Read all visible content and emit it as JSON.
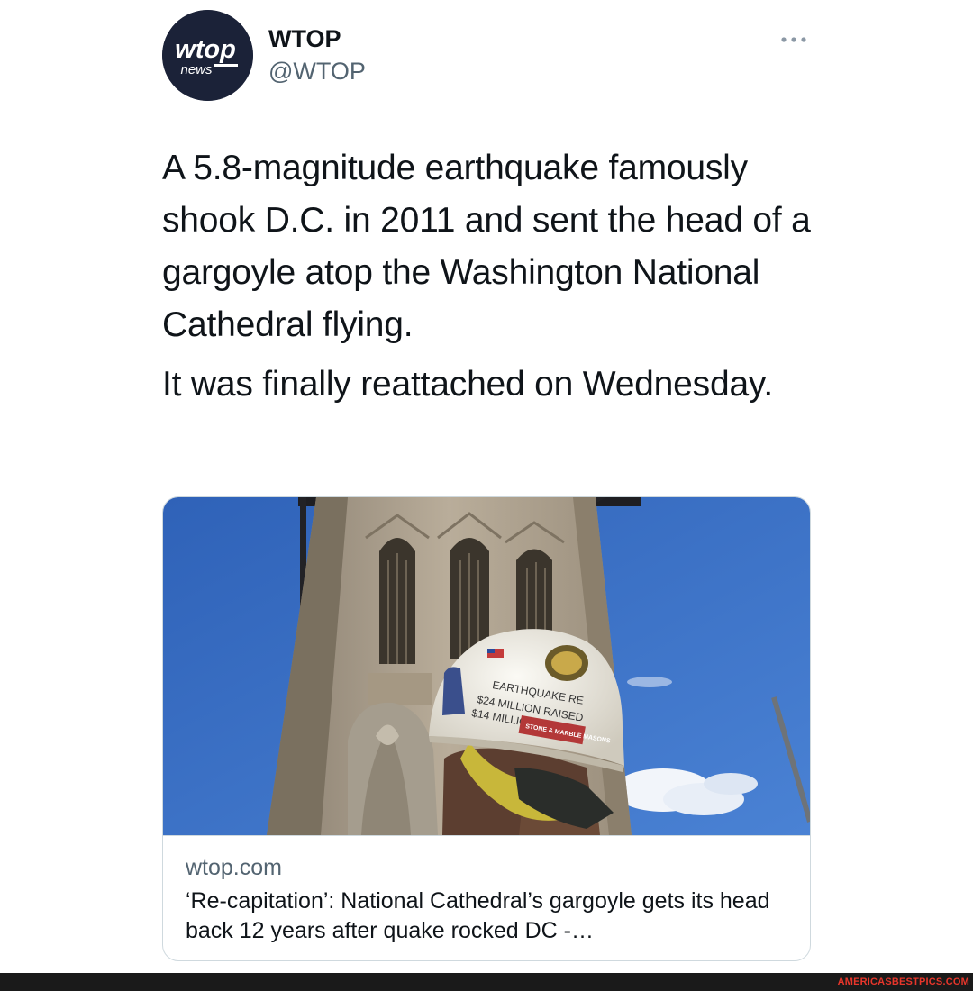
{
  "author": {
    "avatar_icon": "wtop-news-logo-icon",
    "logo_word": "wtop",
    "logo_sub": "news",
    "display_name": "WTOP",
    "handle": "@WTOP"
  },
  "menu": {
    "icon": "more-horizontal-icon"
  },
  "tweet": {
    "paragraphs": [
      "A 5.8-magnitude earthquake famously shook D.C. in 2011 and sent the head of a gargoyle atop the Washington National Cathedral flying.",
      "It was finally reattached on Wednesday."
    ]
  },
  "card": {
    "image_icon": "cathedral-photo",
    "helmet_text": [
      "EARTHQUAKE RE",
      "$24 MILLION RAISED",
      "$14 MILLION NEEDED",
      "STONE & MARBLE MASONS"
    ],
    "domain": "wtop.com",
    "title": "‘Re-capitation’: National Cathedral’s gargoyle gets its head back 12 years after quake rocked DC -…"
  },
  "footer": {
    "watermark": "AMERICASBESTPICS.COM"
  },
  "colors": {
    "text": "#0f1419",
    "secondary": "#536471",
    "border": "#cfd9de",
    "avatar_bg": "#1b2238",
    "sky": "#3b6fc6",
    "watermark": "#e8362b"
  }
}
